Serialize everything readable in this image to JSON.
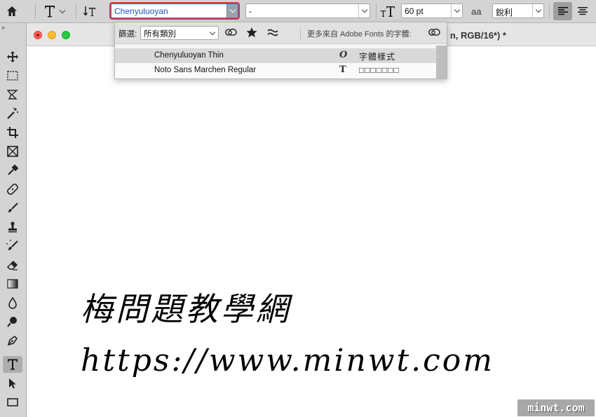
{
  "options_bar": {
    "font_family": "Chenyuluoyan",
    "font_style": "-",
    "font_size": "60 pt",
    "antialias_icon_text": "aa",
    "antialias": "銳利"
  },
  "font_popup": {
    "filter_label": "篩選:",
    "filter_value": "所有類別",
    "more_from": "更多來自 Adobe Fonts 的字體:",
    "fonts": [
      {
        "name": "Chenyuluoyan Thin",
        "type_icon": "O",
        "sample": "字體樣式"
      },
      {
        "name": "Noto Sans Marchen Regular",
        "type_icon": "T",
        "sample": "□□□□□□□"
      }
    ]
  },
  "document": {
    "title_tail": "n, RGB/16*) *"
  },
  "canvas_text": {
    "line1": "梅問題教學網",
    "line2": "https://www.minwt.com"
  },
  "watermark": "minwt.com",
  "colors": {
    "accent_blue": "#1e57b8",
    "highlight_red": "#d53840",
    "close_red": "#fe5f57",
    "min_yellow": "#febc2e",
    "zoom_green": "#28c840"
  }
}
